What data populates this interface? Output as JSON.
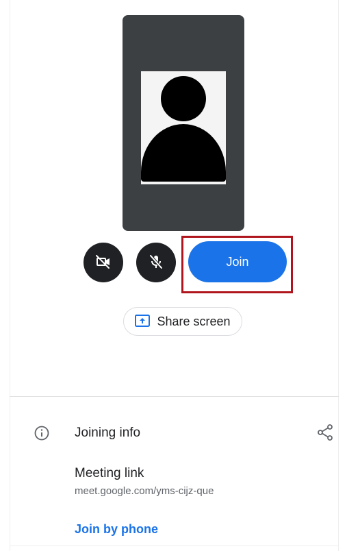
{
  "preview": {
    "avatar_icon": "person-silhouette"
  },
  "controls": {
    "camera_icon": "video-off-icon",
    "mic_icon": "mic-off-icon",
    "join_label": "Join"
  },
  "share_screen": {
    "icon": "present-to-all-icon",
    "label": "Share screen"
  },
  "joining_info": {
    "icon": "info-icon",
    "title": "Joining info",
    "share_icon": "share-icon",
    "meeting_link_label": "Meeting link",
    "meeting_link_url": "meet.google.com/yms-cijz-que",
    "join_by_phone_label": "Join by phone"
  },
  "colors": {
    "accent": "#1a73e8",
    "preview_bg": "#3c4043",
    "control_bg": "#202124",
    "highlight": "#b0141c"
  }
}
